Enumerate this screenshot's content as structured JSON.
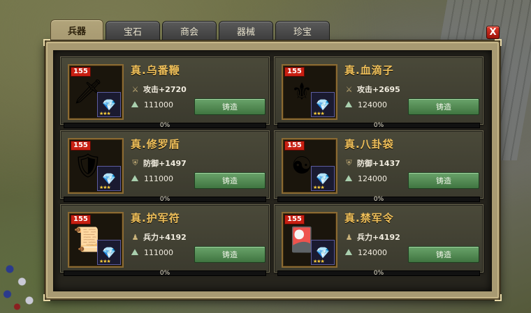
{
  "tabs": [
    {
      "label": "兵器",
      "active": true
    },
    {
      "label": "宝石",
      "active": false
    },
    {
      "label": "商会",
      "active": false
    },
    {
      "label": "器械",
      "active": false
    },
    {
      "label": "珍宝",
      "active": false
    }
  ],
  "close_label": "X",
  "items": [
    {
      "level": "155",
      "name": "真.乌番鞭",
      "stat_icon": "sword-icon",
      "stat": "攻击+2720",
      "cost": "111000",
      "button": "铸造",
      "progress": "0%",
      "progress_value": 0,
      "art": "🗡",
      "gem": "💎",
      "stars": "★★★"
    },
    {
      "level": "155",
      "name": "真.血滴子",
      "stat_icon": "sword-icon",
      "stat": "攻击+2695",
      "cost": "124000",
      "button": "铸造",
      "progress": "0%",
      "progress_value": 0,
      "art": "⚜",
      "gem": "💎",
      "stars": "★★★"
    },
    {
      "level": "155",
      "name": "真.修罗盾",
      "stat_icon": "shield-icon",
      "stat": "防御+1497",
      "cost": "111000",
      "button": "铸造",
      "progress": "0%",
      "progress_value": 0,
      "art": "🛡",
      "gem": "💎",
      "stars": "★★★"
    },
    {
      "level": "155",
      "name": "真.八卦袋",
      "stat_icon": "shield-icon",
      "stat": "防御+1437",
      "cost": "124000",
      "button": "铸造",
      "progress": "0%",
      "progress_value": 0,
      "art": "☯",
      "gem": "💎",
      "stars": "★★★"
    },
    {
      "level": "155",
      "name": "真.护军符",
      "stat_icon": "soldier-icon",
      "stat": "兵力+4192",
      "cost": "111000",
      "button": "铸造",
      "progress": "0%",
      "progress_value": 0,
      "art": "📜",
      "gem": "💎",
      "stars": "★★★"
    },
    {
      "level": "155",
      "name": "真.禁军令",
      "stat_icon": "soldier-icon",
      "stat": "兵力+4192",
      "cost": "124000",
      "button": "铸造",
      "progress": "0%",
      "progress_value": 0,
      "art": "🎴",
      "gem": "💎",
      "stars": "★★★"
    }
  ],
  "colors": {
    "accent_gold": "#f0c05a",
    "forge_green": "#4f8a50",
    "level_red": "#c81f12"
  }
}
